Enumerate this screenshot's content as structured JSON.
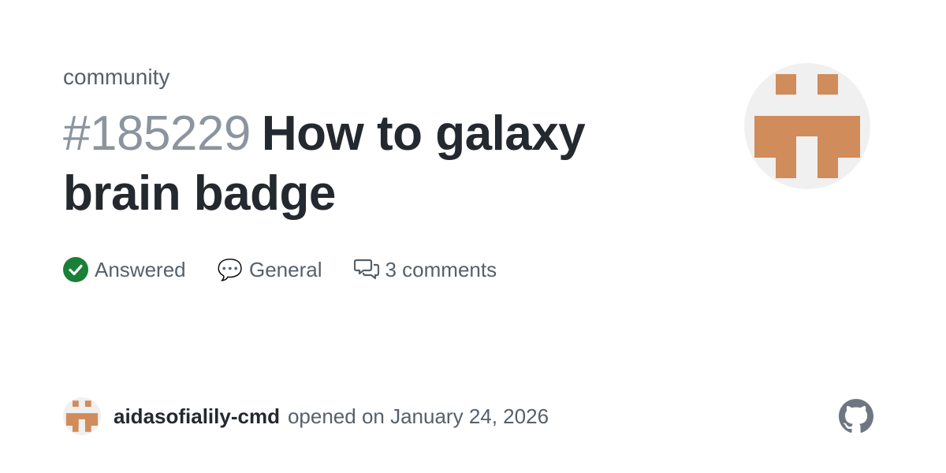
{
  "repo_name": "community",
  "discussion": {
    "number": "#185229",
    "title": "How to galaxy brain badge"
  },
  "meta": {
    "status": "Answered",
    "category_emoji": "💬",
    "category": "General",
    "comments": "3 comments"
  },
  "footer": {
    "author": "aidasofialily-cmd",
    "opened_text": "opened on January 24, 2026"
  },
  "colors": {
    "answered_green": "#1a7f37",
    "identicon": "#d08c5a",
    "identicon_bg": "#f0f0f0",
    "github_logo": "#6e7781"
  },
  "icons": [
    "check-circle-icon",
    "speech-balloon-icon",
    "comment-discussion-icon",
    "github-logo-icon"
  ]
}
